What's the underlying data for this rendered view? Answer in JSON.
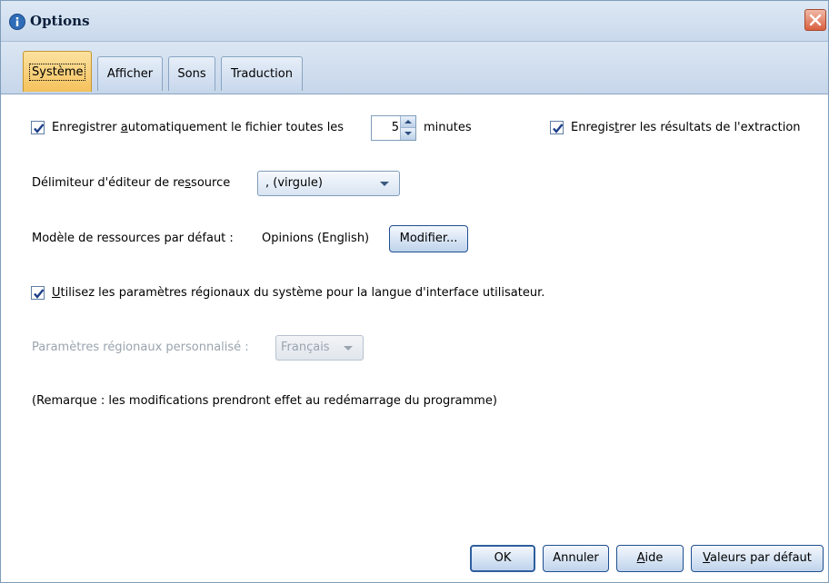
{
  "window": {
    "title": "Options",
    "icon": "info-icon",
    "close_icon": "close-icon"
  },
  "tabs": [
    {
      "label": "Système",
      "active": true
    },
    {
      "label": "Afficher",
      "active": false
    },
    {
      "label": "Sons",
      "active": false
    },
    {
      "label": "Traduction",
      "active": false
    }
  ],
  "autosave": {
    "checked": true,
    "label_pre": "Enregistrer ",
    "label_mnemonic": "a",
    "label_post": "utomatiquement le fichier toutes les",
    "value": "5",
    "unit": "minutes"
  },
  "save_extraction": {
    "checked": true,
    "label_pre": "Enregis",
    "label_mnemonic": "t",
    "label_post": "rer les résultats de l'extraction"
  },
  "delimiter": {
    "label_pre": "Délimiteur d'éditeur de re",
    "label_mnemonic": "s",
    "label_post": "source",
    "value": ", (virgule)"
  },
  "resource_template": {
    "label": "Modèle de ressources par défaut :",
    "value": "Opinions (English)",
    "button": "Modifier..."
  },
  "use_system_locale": {
    "checked": true,
    "label_mnemonic": "U",
    "label_post": "tilisez les paramètres régionaux du système pour la langue d'interface utilisateur."
  },
  "custom_locale": {
    "label": "Paramètres régionaux personnalisé :",
    "value": "Français",
    "disabled": true
  },
  "note": "(Remarque : les modifications prendront effet au redémarrage du programme)",
  "buttons": {
    "ok": "OK",
    "cancel": "Annuler",
    "help_mnemonic": "A",
    "help_post": "ide",
    "defaults_mnemonic": "V",
    "defaults_post": "aleurs par défaut"
  },
  "colors": {
    "active_tab": "#f5c15c",
    "title_bar": "#c9d9ec",
    "close_button": "#d96040",
    "check_mark": "#1e3f8a"
  }
}
